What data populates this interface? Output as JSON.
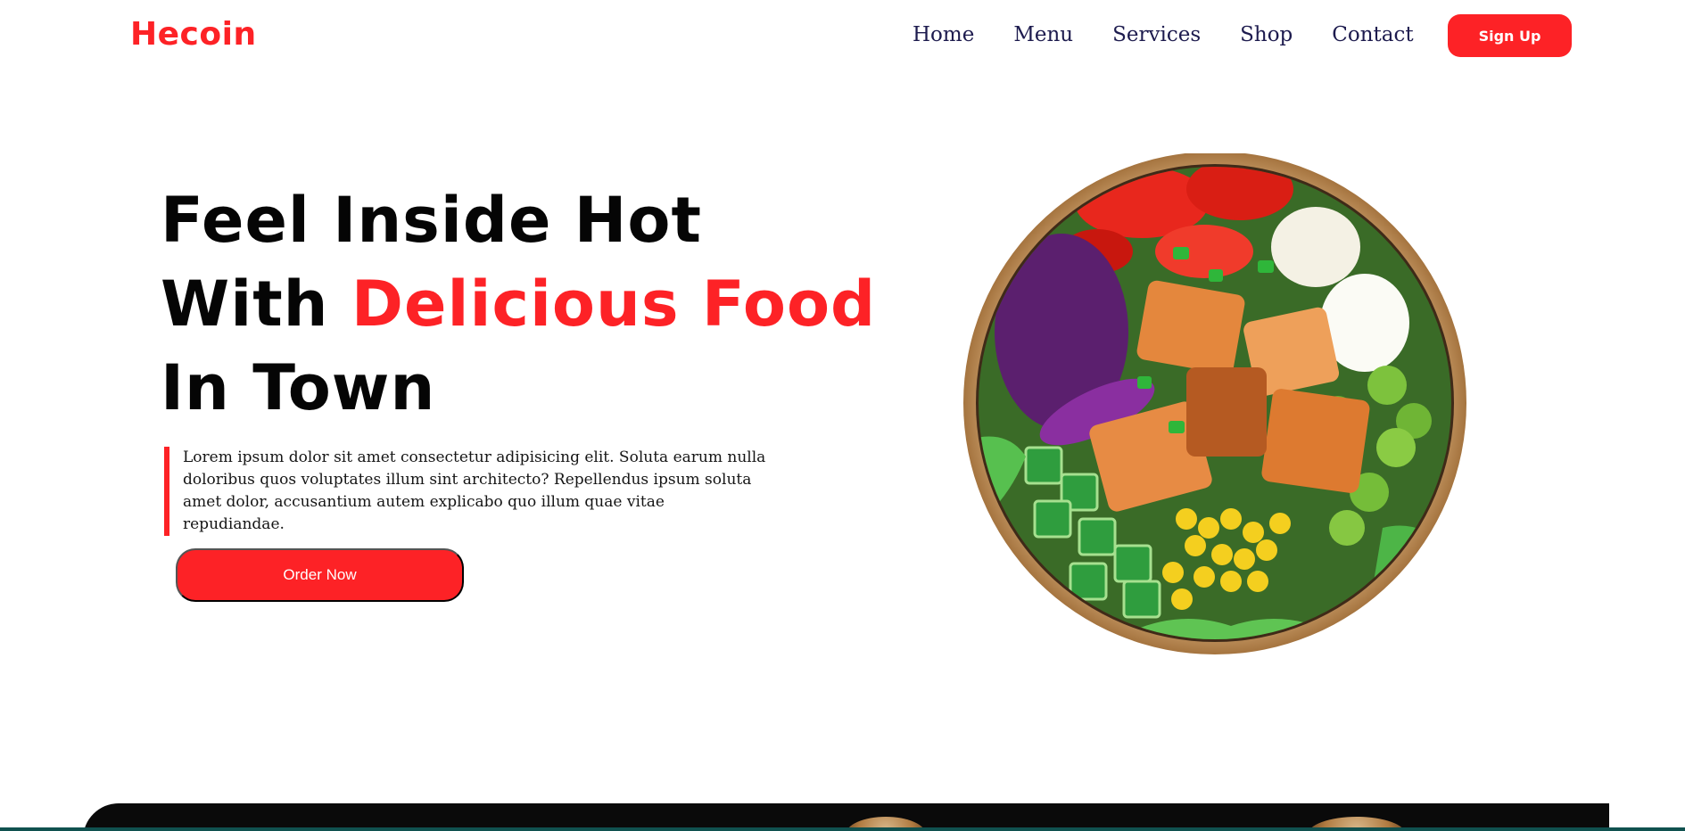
{
  "header": {
    "logo": "Hecoin",
    "nav": [
      "Home",
      "Menu",
      "Services",
      "Shop",
      "Contact"
    ],
    "signup_label": "Sign Up"
  },
  "hero": {
    "line1": "Feel Inside Hot",
    "line2_plain": "With ",
    "line2_accent": "Delicious Food",
    "line3": "In Town",
    "description": "Lorem ipsum dolor sit amet consectetur adipisicing elit. Soluta earum nulla doloribus quos voluptates illum sint architecto? Repellendus ipsum soluta amet dolor, accusantium autem explicabo quo illum quae vitae repudiandae.",
    "order_label": "Order Now"
  },
  "colors": {
    "accent": "#fd2226",
    "nav_text": "#1d1b4e",
    "dark_band": "#0a0a0a",
    "teal_line": "#10514f"
  },
  "icons": {
    "hero_image": "salad-bowl-image"
  }
}
